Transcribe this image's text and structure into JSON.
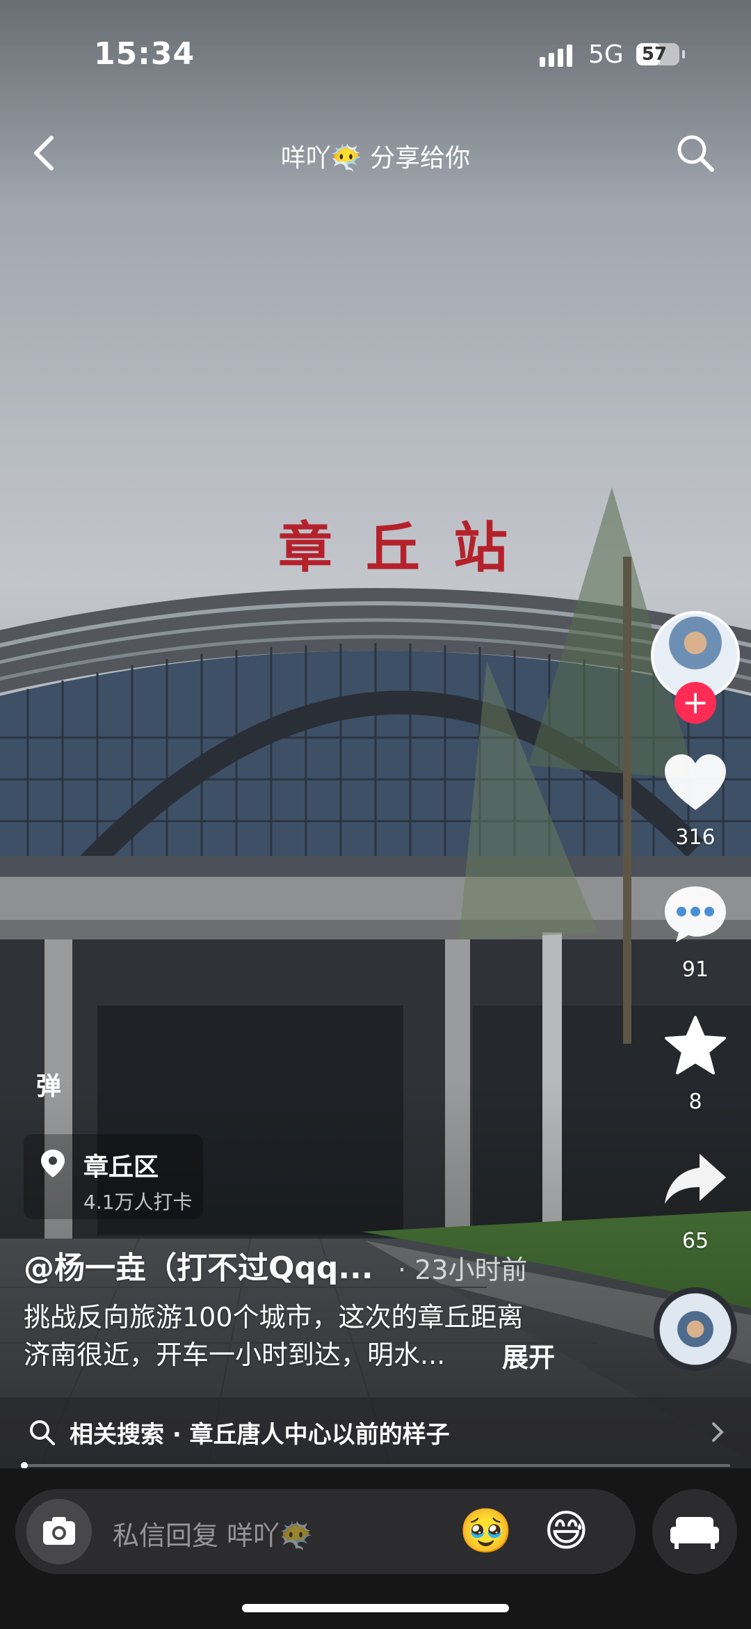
{
  "status_bar": {
    "time": "15:34",
    "network": "5G",
    "battery": "57",
    "battery_level": 0.57
  },
  "nav": {
    "share_title": "咩吖😶‍🌫️ 分享给你"
  },
  "video": {
    "station_sign": "章丘站"
  },
  "rail": {
    "likes": "316",
    "comments": "91",
    "favorites": "8",
    "shares": "65"
  },
  "danmu_label": "弹",
  "location": {
    "place": "章丘区",
    "checkins": "4.1万人打卡"
  },
  "post": {
    "author": "@杨一垚（打不过Qqq...",
    "time": "· 23小时前",
    "caption_line1": "挑战反向旅游100个城市，这次的章丘距离",
    "caption_line2": "济南很近，开车一小时到达，明水...",
    "expand": "展开"
  },
  "related_search": {
    "label": "相关搜索 · 章丘唐人中心以前的样子"
  },
  "reply": {
    "placeholder": "私信回复 咩吖😶‍🌫️",
    "emoji1": "🥹",
    "emoji2": "😅"
  },
  "icons": [
    "back-icon",
    "search-icon",
    "heart-icon",
    "comment-icon",
    "star-icon",
    "share-icon",
    "location-pin-icon",
    "camera-icon",
    "sofa-icon",
    "chevron-right-icon"
  ],
  "colors": {
    "follow": "#fe2c55",
    "sign": "#b5212b",
    "bottom_bar": "#161616"
  }
}
